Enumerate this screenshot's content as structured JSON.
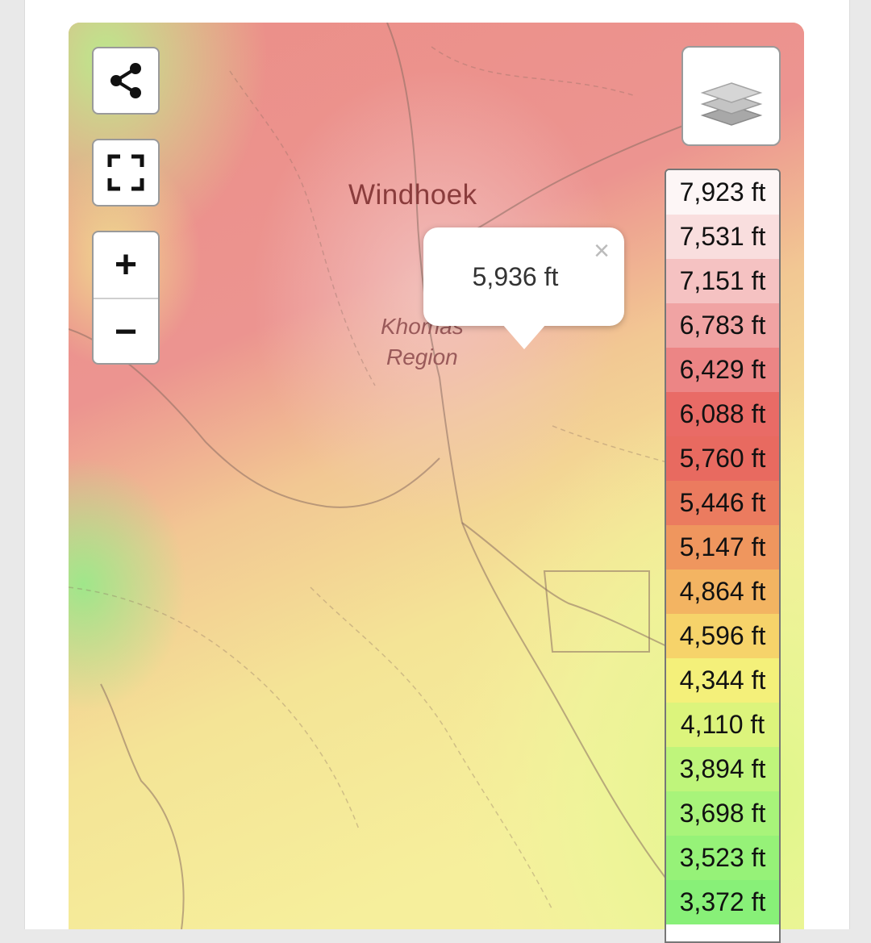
{
  "map": {
    "labels": {
      "city": "Windhoek",
      "region_line1": "Khomas",
      "region_line2": "Region"
    }
  },
  "controls": {
    "share": {
      "icon": "share-icon"
    },
    "fullscreen": {
      "icon": "fullscreen-icon"
    },
    "zoom_in": {
      "label": "+",
      "icon": "plus-icon"
    },
    "zoom_out": {
      "label": "−",
      "icon": "minus-icon"
    },
    "layers": {
      "icon": "layers-icon"
    }
  },
  "popup": {
    "value": "5,936 ft",
    "close_label": "×"
  },
  "legend": {
    "items": [
      {
        "label": "7,923 ft",
        "color": "#fdf6f6"
      },
      {
        "label": "7,531 ft",
        "color": "#f9dede"
      },
      {
        "label": "7,151 ft",
        "color": "#f5c2c2"
      },
      {
        "label": "6,783 ft",
        "color": "#f0a3a3"
      },
      {
        "label": "6,429 ft",
        "color": "#ec8585"
      },
      {
        "label": "6,088 ft",
        "color": "#e96b66"
      },
      {
        "label": "5,760 ft",
        "color": "#e86a60"
      },
      {
        "label": "5,446 ft",
        "color": "#eb7b5f"
      },
      {
        "label": "5,147 ft",
        "color": "#ef965e"
      },
      {
        "label": "4,864 ft",
        "color": "#f3b462"
      },
      {
        "label": "4,596 ft",
        "color": "#f6d36a"
      },
      {
        "label": "4,344 ft",
        "color": "#f4f07a"
      },
      {
        "label": "4,110 ft",
        "color": "#dcf47c"
      },
      {
        "label": "3,894 ft",
        "color": "#bff57b"
      },
      {
        "label": "3,698 ft",
        "color": "#a8f47a"
      },
      {
        "label": "3,523 ft",
        "color": "#96f278"
      },
      {
        "label": "3,372 ft",
        "color": "#88f078"
      }
    ]
  }
}
